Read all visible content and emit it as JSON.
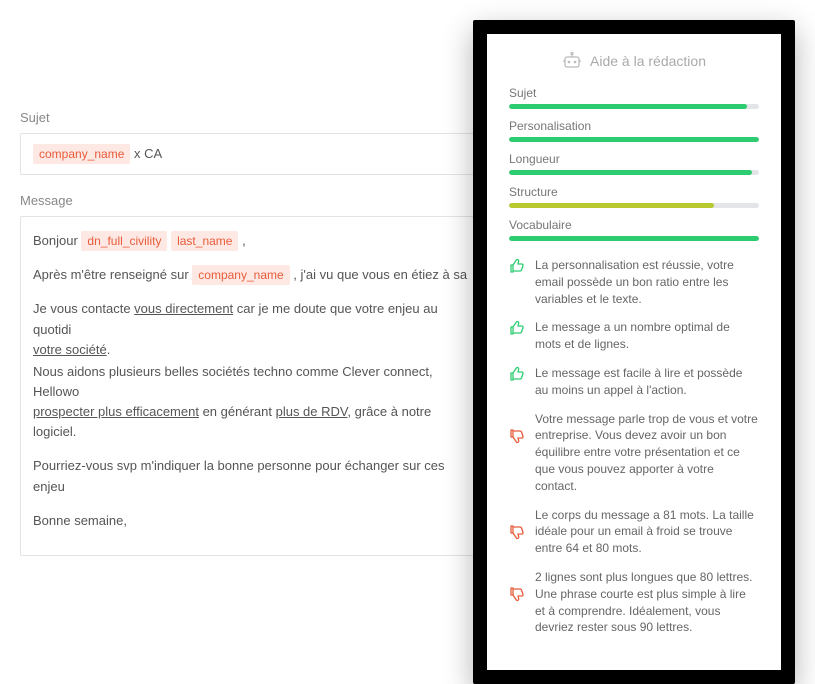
{
  "editor": {
    "subject_label": "Sujet",
    "message_label": "Message",
    "tags": {
      "company_name": "company_name",
      "dn_full_civility": "dn_full_civility",
      "last_name": "last_name"
    },
    "subject_after_tag": " x CA",
    "body": {
      "greeting_before": "Bonjour ",
      "greeting_between": "   ",
      "greeting_after": " ,",
      "p2_before": "Après m'être renseigné sur ",
      "p2_after": " , j'ai vu que vous en étiez à sa",
      "p3_before": "Je vous contacte ",
      "p3_u1": "vous directement",
      "p3_mid": " car je me doute que votre enjeu au quotidi",
      "p3_u2": "votre société",
      "p3_dot1": ".",
      "p4_before": "Nous aidons plusieurs belles sociétés techno comme Clever connect, Hellowo",
      "p4_u1": "prospecter plus efficacement",
      "p4_mid": " en générant ",
      "p4_u2": "plus de RDV",
      "p4_after": ", grâce à notre logiciel.",
      "p5": "Pourriez-vous svp m'indiquer la bonne personne pour échanger sur ces enjeu",
      "p6": "Bonne semaine,"
    }
  },
  "panel": {
    "title": "Aide à la rédaction",
    "metrics": [
      {
        "label": "Sujet",
        "pct": 95,
        "color": "#2ecc71"
      },
      {
        "label": "Personalisation",
        "pct": 100,
        "color": "#2ecc71"
      },
      {
        "label": "Longueur",
        "pct": 97,
        "color": "#2ecc71"
      },
      {
        "label": "Structure",
        "pct": 82,
        "color": "#b7c92f"
      },
      {
        "label": "Vocabulaire",
        "pct": 100,
        "color": "#2ecc71"
      }
    ],
    "tips": [
      {
        "kind": "up",
        "text": "La personnalisation est réussie, votre email possède un bon ratio entre les variables et le texte."
      },
      {
        "kind": "up",
        "text": "Le message a un nombre optimal de mots et de lignes."
      },
      {
        "kind": "up",
        "text": "Le message est facile à lire et possède au moins un appel à l'action."
      },
      {
        "kind": "down",
        "text": "Votre message parle trop de vous et votre entreprise. Vous devez avoir un bon équilibre entre votre présentation et ce que vous pouvez apporter à votre contact."
      },
      {
        "kind": "down",
        "text": "Le corps du message a 81 mots. La taille idéale pour un email à froid se trouve entre 64 et 80 mots."
      },
      {
        "kind": "down",
        "text": "2 lignes sont plus longues que 80 lettres. Une phrase courte est plus simple à lire et à comprendre. Idéalement, vous devriez rester sous 90 lettres."
      }
    ]
  },
  "icon_colors": {
    "up": "#2ecc71",
    "down": "#e85c3a"
  }
}
